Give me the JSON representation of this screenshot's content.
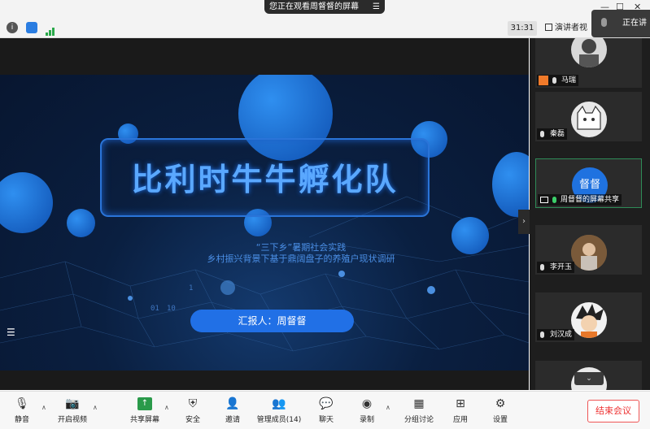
{
  "banner": {
    "text": "您正在观看周督督的屏幕",
    "menu_icon": "menu-icon"
  },
  "topbar": {
    "timer": "31:31",
    "view_label": "演讲者视",
    "speaking": "正在讲话"
  },
  "slide": {
    "title": "比利时牛牛孵化队",
    "subtitle1": "“三下乡”暑期社会实践",
    "subtitle2": "乡村振兴背景下基于鼎阔盘子的养殖户现状调研",
    "reporter": "汇报人：周督督"
  },
  "participants": [
    {
      "name": "马瑞"
    },
    {
      "name": "秦磊"
    },
    {
      "name": "周督督的屏幕共享",
      "avatar_text": "督督"
    },
    {
      "name": "李开玉"
    },
    {
      "name": "刘汉成"
    }
  ],
  "toolbar": {
    "mute": "静音",
    "video": "开启视频",
    "share": "共享屏幕",
    "security": "安全",
    "invite": "邀请",
    "members": "管理成员(14)",
    "chat": "聊天",
    "record": "录制",
    "breakout": "分组讨论",
    "apps": "应用",
    "settings": "设置",
    "end": "结束会议"
  },
  "colors": {
    "accent": "#2170e6",
    "end": "#e33333",
    "slide_bg": "#081630"
  }
}
